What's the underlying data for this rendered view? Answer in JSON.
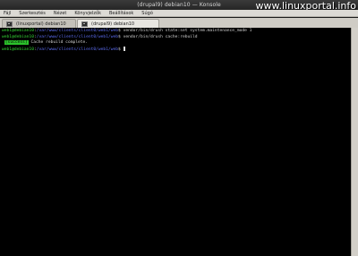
{
  "window": {
    "title": "(drupal9) debian10 — Konsole",
    "watermark": "www.linuxportal.info"
  },
  "menubar": {
    "items": [
      "Fájl",
      "Szerkesztés",
      "Nézet",
      "Könyvjelzők",
      "Beállítások",
      "Súgó"
    ]
  },
  "tabs": [
    {
      "label": "(linuxportal) debian10",
      "active": false
    },
    {
      "label": "(drupal9) debian10",
      "active": true
    }
  ],
  "terminal": {
    "lines": [
      {
        "user": "web1@debian10",
        "sep": ":",
        "path": "/var/www/clients/client0/web1/web",
        "prompt": "$",
        "command": "vendor/bin/drush state:set system.maintenance_mode 1"
      },
      {
        "user": "web1@debian10",
        "sep": ":",
        "path": "/var/www/clients/client0/web1/web",
        "prompt": "$",
        "command": "vendor/bin/drush cache:rebuild"
      },
      {
        "badge": "[success]",
        "message": " Cache rebuild complete."
      },
      {
        "user": "web1@debian10",
        "sep": ":",
        "path": "/var/www/clients/client0/web1/web",
        "prompt": "$",
        "command": ""
      }
    ]
  },
  "colors": {
    "prompt_user": "#34d534",
    "prompt_path": "#5c6cf0",
    "success_badge": "#2cc32c",
    "terminal_bg": "#000000"
  }
}
